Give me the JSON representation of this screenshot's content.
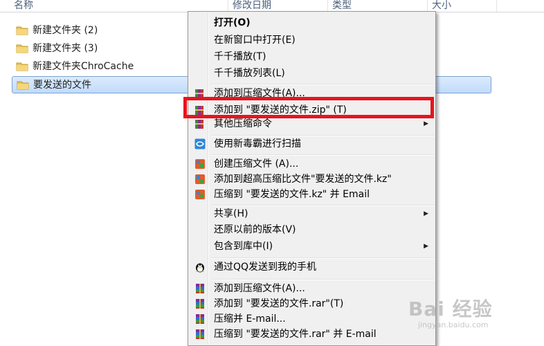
{
  "columns": [
    "名称",
    "修改日期",
    "类型",
    "大小"
  ],
  "files": [
    {
      "name": "新建文件夹 (2)",
      "icon": "folder-icon"
    },
    {
      "name": "新建文件夹 (3)",
      "icon": "folder-icon"
    },
    {
      "name": "新建文件夹ChroCache",
      "icon": "folder-icon"
    },
    {
      "name": "要发送的文件",
      "icon": "folder-icon",
      "selected": true
    }
  ],
  "menu": {
    "group1": [
      "打开(O)",
      "在新窗口中打开(E)",
      "千千播放(T)",
      "千千播放列表(L)"
    ],
    "group2": [
      "添加到压缩文件(A)...",
      "添加到 \"要发送的文件.zip\" (T)",
      "其他压缩命令"
    ],
    "group3": [
      "使用新毒霸进行扫描"
    ],
    "group4": [
      "创建压缩文件 (A)...",
      "添加到超高压缩比文件\"要发送的文件.kz\"",
      "压缩到 \"要发送的文件.kz\" 并 Email"
    ],
    "group5": [
      "共享(H)",
      "还原以前的版本(V)",
      "包含到库中(I)"
    ],
    "group6": [
      "通过QQ发送到我的手机"
    ],
    "group7": [
      "添加到压缩文件(A)...",
      "添加到 \"要发送的文件.rar\"(T)",
      "压缩并 E-mail...",
      "压缩到 \"要发送的文件.rar\" 并 E-mail"
    ]
  },
  "highlight_color": "#e8141c",
  "watermark": {
    "main": "Bai 经验",
    "sub": "jingyan.baidu.com"
  }
}
